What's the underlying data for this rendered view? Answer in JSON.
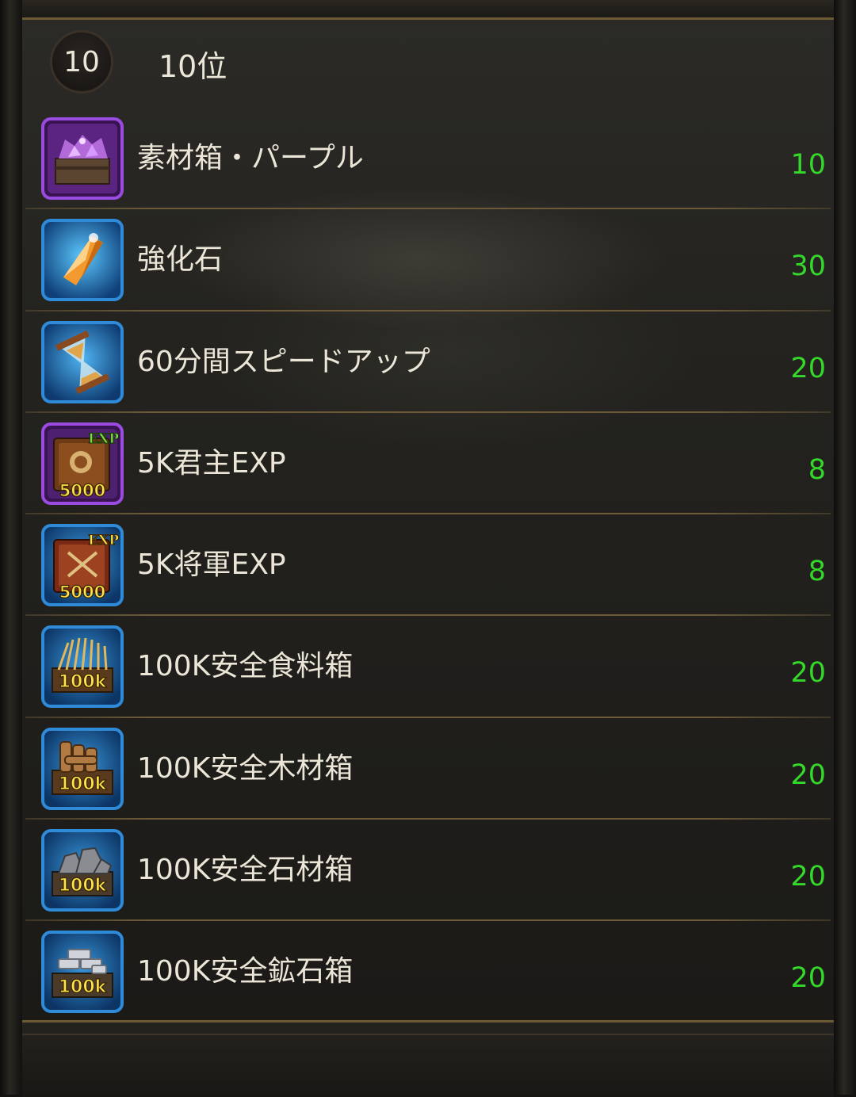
{
  "rank": {
    "number": "10",
    "title": "10位"
  },
  "rewards": [
    {
      "name": "素材箱・パープル",
      "qty": "10",
      "icon": "purple-material-chest-icon"
    },
    {
      "name": "強化石",
      "qty": "30",
      "icon": "enhancement-stone-icon"
    },
    {
      "name": "60分間スピードアップ",
      "qty": "20",
      "icon": "hourglass-speedup-icon"
    },
    {
      "name": "5K君主EXP",
      "qty": "8",
      "icon": "lord-exp-book-icon",
      "badge": "5000",
      "tag": "EXP"
    },
    {
      "name": "5K将軍EXP",
      "qty": "8",
      "icon": "general-exp-book-icon",
      "badge": "5000",
      "tag": "EXP"
    },
    {
      "name": "100K安全食料箱",
      "qty": "20",
      "icon": "food-crate-icon",
      "badge": "100k"
    },
    {
      "name": "100K安全木材箱",
      "qty": "20",
      "icon": "wood-crate-icon",
      "badge": "100k"
    },
    {
      "name": "100K安全石材箱",
      "qty": "20",
      "icon": "stone-crate-icon",
      "badge": "100k"
    },
    {
      "name": "100K安全鉱石箱",
      "qty": "20",
      "icon": "ore-crate-icon",
      "badge": "100k"
    }
  ],
  "colors": {
    "quantity": "#35d72b",
    "text": "#ece6d8",
    "divider": "#6c5a38",
    "frame_purple": "#8a3ed6",
    "frame_blue": "#2f8ad8"
  }
}
